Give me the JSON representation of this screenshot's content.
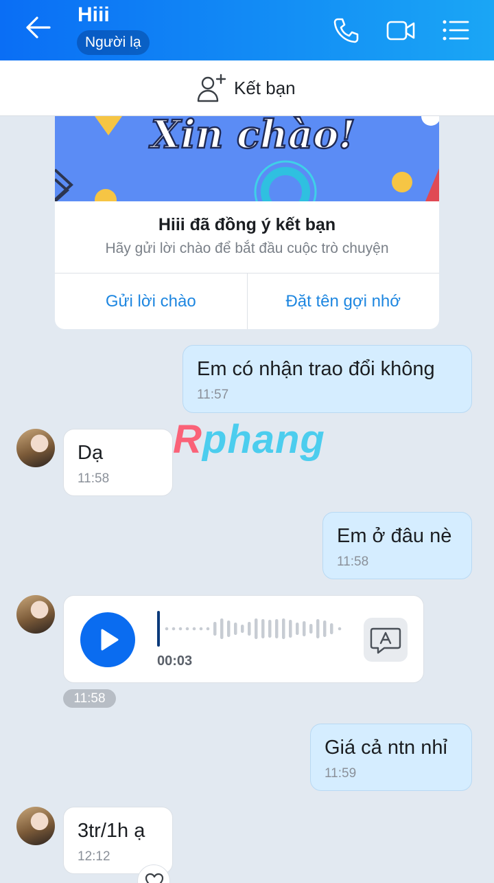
{
  "header": {
    "title": "Hiii",
    "badge": "Người lạ",
    "icons": [
      "back-arrow-icon",
      "phone-icon",
      "video-call-icon",
      "menu-list-icon"
    ],
    "gradient": [
      "#0a6ef5",
      "#1aa6f5"
    ]
  },
  "add_friend": {
    "label": "Kết bạn",
    "icon": "add-person-icon"
  },
  "greeting_card": {
    "banner_text": "Xin chào!",
    "title": "Hiii đã đồng ý kết bạn",
    "subtitle": "Hãy gửi lời chào để bắt đầu cuộc trò chuyện",
    "actions": [
      "Gửi lời chào",
      "Đặt tên gợi nhớ"
    ]
  },
  "messages": [
    {
      "direction": "out",
      "text": "Em có nhận trao đổi không",
      "time": "11:57"
    },
    {
      "direction": "in",
      "text": "Dạ",
      "time": "11:58"
    },
    {
      "direction": "out",
      "text": "Em ở đâu nè",
      "time": "11:58"
    },
    {
      "direction": "in",
      "type": "voice",
      "duration": "00:03",
      "time": "11:58"
    },
    {
      "direction": "out",
      "text": "Giá cả ntn nhỉ",
      "time": "11:59"
    },
    {
      "direction": "in",
      "text": "3tr/1h ạ",
      "time": "12:12"
    }
  ],
  "watermark": {
    "first": "R",
    "rest": "phang"
  },
  "colors": {
    "accent": "#0a6cf0",
    "out_bubble": "#d5edff",
    "background": "#e2e9f1",
    "link": "#1d86e0"
  }
}
